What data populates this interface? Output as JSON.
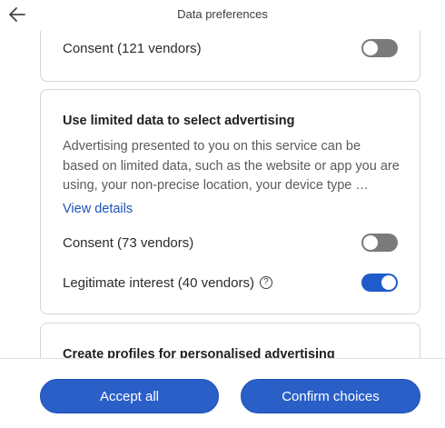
{
  "header": {
    "title": "Data preferences",
    "back_icon": "arrow-left-icon"
  },
  "card_consent_top": {
    "label": "Consent (121 vendors)",
    "toggle_on": false
  },
  "card_limited_data": {
    "title": "Use limited data to select advertising",
    "description": "Advertising presented to you on this service can be based on limited data, such as the website or app you are using, your non-precise location, your device type …",
    "view_details": "View details",
    "consent_label": "Consent (73 vendors)",
    "consent_toggle_on": false,
    "legit_label": "Legitimate interest (40 vendors)",
    "legit_toggle_on": true,
    "help_icon": "question-circle-icon"
  },
  "card_profiles": {
    "title": "Create profiles for personalised advertising"
  },
  "footer": {
    "accept_label": "Accept all",
    "confirm_label": "Confirm choices"
  },
  "colors": {
    "accent": "#2a5fc8",
    "link": "#1c52b8",
    "toggle_off": "#7a7a7a",
    "toggle_on": "#1f5bc9"
  }
}
